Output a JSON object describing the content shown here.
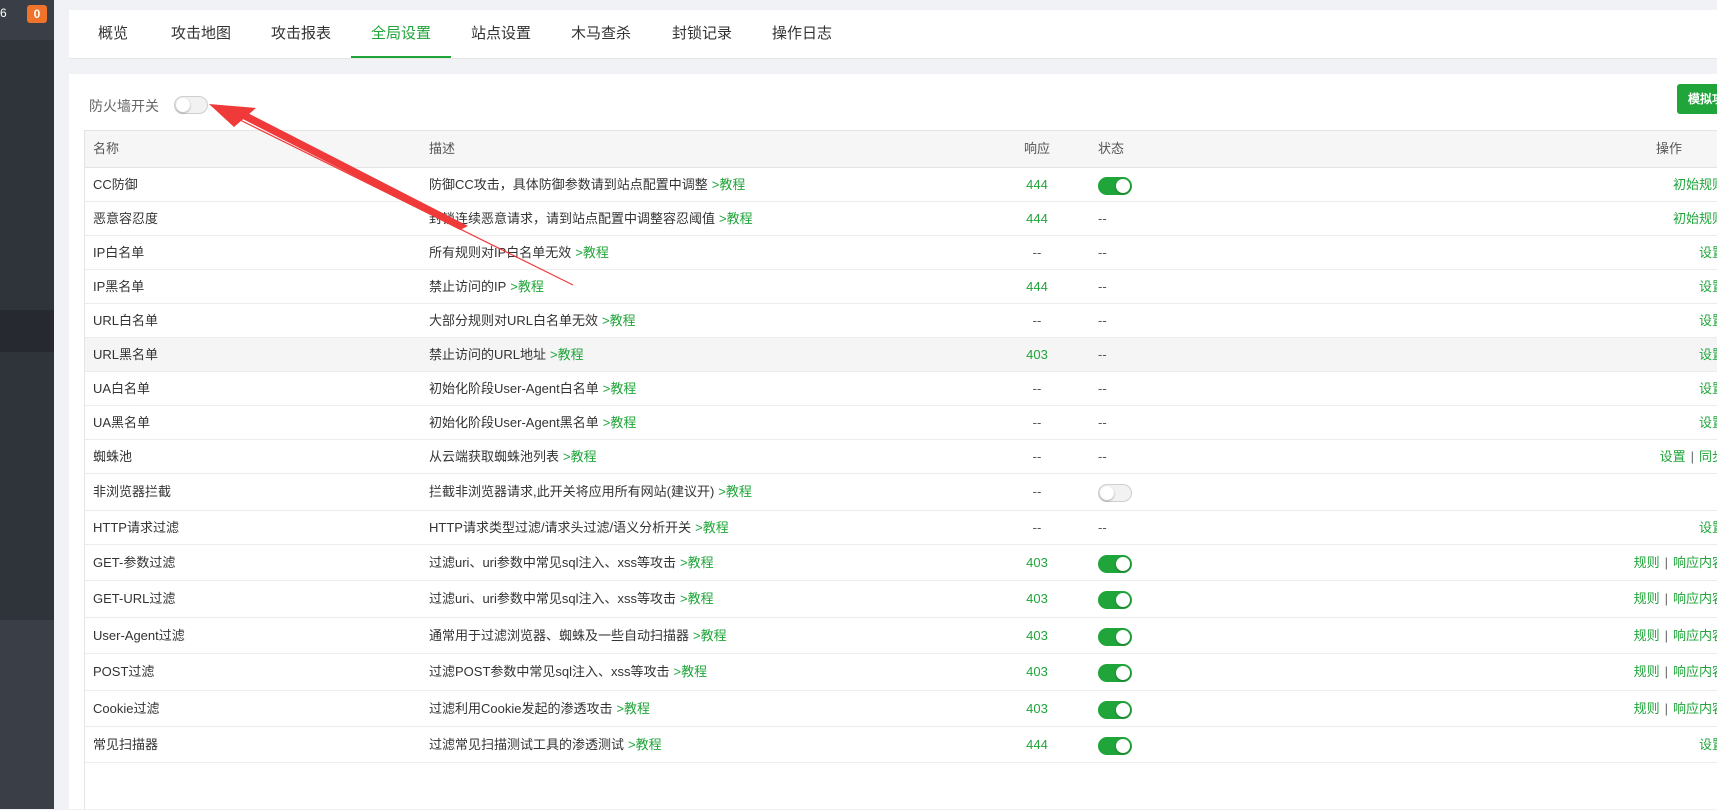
{
  "sidebar": {
    "top_text": "6",
    "badge": "0"
  },
  "tabs": [
    {
      "label": "概览",
      "active": false
    },
    {
      "label": "攻击地图",
      "active": false
    },
    {
      "label": "攻击报表",
      "active": false
    },
    {
      "label": "全局设置",
      "active": true
    },
    {
      "label": "站点设置",
      "active": false
    },
    {
      "label": "木马查杀",
      "active": false
    },
    {
      "label": "封锁记录",
      "active": false
    },
    {
      "label": "操作日志",
      "active": false
    }
  ],
  "firewall": {
    "label": "防火墙开关",
    "enabled": false
  },
  "simulate_button": "模拟攻击",
  "table": {
    "headers": {
      "name": "名称",
      "desc": "描述",
      "resp": "响应",
      "status": "状态",
      "op": "操作"
    },
    "rows": [
      {
        "name": "CC防御",
        "desc": "防御CC攻击，具体防御参数请到站点配置中调整",
        "link": ">教程",
        "resp": "444",
        "status": "on",
        "ops": [
          "初始规则"
        ]
      },
      {
        "name": "恶意容忍度",
        "desc": "封锁连续恶意请求，请到站点配置中调整容忍阈值",
        "link": ">教程",
        "resp": "444",
        "status": "--",
        "ops": [
          "初始规则"
        ]
      },
      {
        "name": "IP白名单",
        "desc": "所有规则对IP白名单无效",
        "link": ">教程",
        "resp": "--",
        "status": "--",
        "ops": [
          "设置"
        ]
      },
      {
        "name": "IP黑名单",
        "desc": "禁止访问的IP",
        "link": ">教程",
        "resp": "444",
        "status": "--",
        "ops": [
          "设置"
        ]
      },
      {
        "name": "URL白名单",
        "desc": "大部分规则对URL白名单无效",
        "link": ">教程",
        "resp": "--",
        "status": "--",
        "ops": [
          "设置"
        ]
      },
      {
        "name": "URL黑名单",
        "desc": "禁止访问的URL地址",
        "link": ">教程",
        "resp": "403",
        "status": "--",
        "ops": [
          "设置"
        ],
        "highlight": true
      },
      {
        "name": "UA白名单",
        "desc": "初始化阶段User-Agent白名单",
        "link": ">教程",
        "resp": "--",
        "status": "--",
        "ops": [
          "设置"
        ]
      },
      {
        "name": "UA黑名单",
        "desc": "初始化阶段User-Agent黑名单",
        "link": ">教程",
        "resp": "--",
        "status": "--",
        "ops": [
          "设置"
        ]
      },
      {
        "name": "蜘蛛池",
        "desc": "从云端获取蜘蛛池列表",
        "link": ">教程",
        "resp": "--",
        "status": "--",
        "ops": [
          "设置",
          "同步"
        ]
      },
      {
        "name": "非浏览器拦截",
        "desc": "拦截非浏览器请求,此开关将应用所有网站(建议开)",
        "link": ">教程",
        "resp": "--",
        "status": "off",
        "ops": []
      },
      {
        "name": "HTTP请求过滤",
        "desc": "HTTP请求类型过滤/请求头过滤/语义分析开关",
        "link": ">教程",
        "resp": "--",
        "status": "--",
        "ops": [
          "设置"
        ]
      },
      {
        "name": "GET-参数过滤",
        "desc": "过滤uri、uri参数中常见sql注入、xss等攻击",
        "link": ">教程",
        "resp": "403",
        "status": "on",
        "ops": [
          "规则",
          "响应内容"
        ]
      },
      {
        "name": "GET-URL过滤",
        "desc": "过滤uri、uri参数中常见sql注入、xss等攻击",
        "link": ">教程",
        "resp": "403",
        "status": "on",
        "ops": [
          "规则",
          "响应内容"
        ]
      },
      {
        "name": "User-Agent过滤",
        "desc": "通常用于过滤浏览器、蜘蛛及一些自动扫描器",
        "link": ">教程",
        "resp": "403",
        "status": "on",
        "ops": [
          "规则",
          "响应内容"
        ]
      },
      {
        "name": "POST过滤",
        "desc": "过滤POST参数中常见sql注入、xss等攻击",
        "link": ">教程",
        "resp": "403",
        "status": "on",
        "ops": [
          "规则",
          "响应内容"
        ]
      },
      {
        "name": "Cookie过滤",
        "desc": "过滤利用Cookie发起的渗透攻击",
        "link": ">教程",
        "resp": "403",
        "status": "on",
        "ops": [
          "规则",
          "响应内容"
        ]
      },
      {
        "name": "常见扫描器",
        "desc": "过滤常见扫描测试工具的渗透测试",
        "link": ">教程",
        "resp": "444",
        "status": "on",
        "ops": [
          "设置"
        ]
      }
    ]
  },
  "colors": {
    "accent": "#20a53a",
    "arrow": "#f03a3a",
    "sidebar": "#3a3f47"
  }
}
